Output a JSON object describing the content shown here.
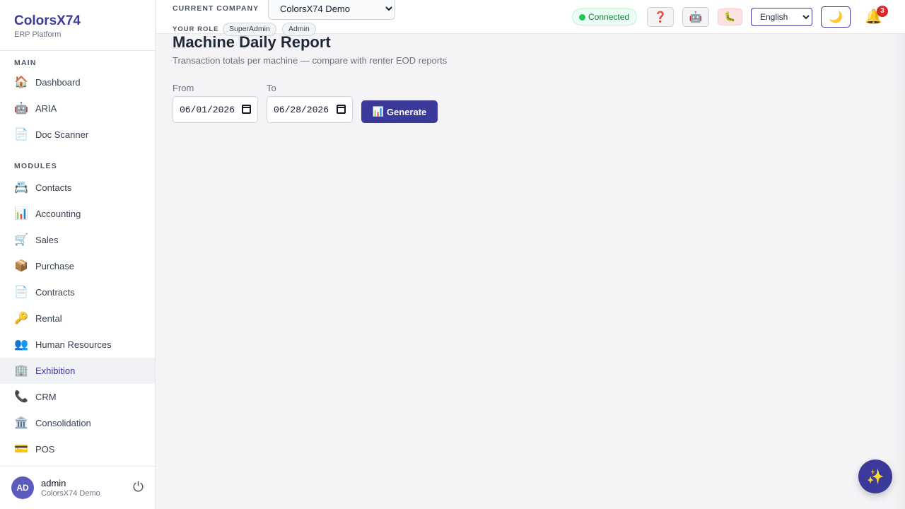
{
  "brand": {
    "name": "ColorsX74",
    "subtitle": "ERP Platform"
  },
  "sidebar": {
    "sections": [
      {
        "title": "MAIN",
        "items": [
          {
            "label": "Dashboard",
            "icon": "🏠"
          },
          {
            "label": "ARIA",
            "icon": "🤖"
          },
          {
            "label": "Doc Scanner",
            "icon": "📄"
          }
        ]
      },
      {
        "title": "MODULES",
        "items": [
          {
            "label": "Contacts",
            "icon": "📇"
          },
          {
            "label": "Accounting",
            "icon": "📊"
          },
          {
            "label": "Sales",
            "icon": "🛒"
          },
          {
            "label": "Purchase",
            "icon": "📦"
          },
          {
            "label": "Contracts",
            "icon": "📄"
          },
          {
            "label": "Rental",
            "icon": "🔑"
          },
          {
            "label": "Human Resources",
            "icon": "👥"
          },
          {
            "label": "Exhibition",
            "icon": "🏢",
            "active": true
          },
          {
            "label": "CRM",
            "icon": "📞"
          },
          {
            "label": "Consolidation",
            "icon": "🏛️"
          },
          {
            "label": "POS",
            "icon": "💳"
          }
        ]
      }
    ]
  },
  "user": {
    "initials": "AD",
    "name": "admin",
    "company": "ColorsX74 Demo",
    "logout_icon": "power-icon"
  },
  "topbar": {
    "company_label": "CURRENT COMPANY",
    "company_selected": "ColorsX74 Demo",
    "role_label": "YOUR ROLE",
    "roles": [
      "SuperAdmin",
      "Admin"
    ],
    "connection_status": "Connected",
    "help_icon": "❓",
    "bot_icon": "🤖",
    "bug_icon": "🐛",
    "language": "English",
    "theme_icon": "🌙",
    "bell_icon": "🔔",
    "notification_count": "3"
  },
  "page": {
    "title": "Machine Daily Report",
    "subtitle": "Transaction totals per machine — compare with renter EOD reports",
    "from_label": "From",
    "from_value": "06/01/2026",
    "to_label": "To",
    "to_value": "06/28/2026",
    "generate_icon": "📊",
    "generate_label": "Generate",
    "fab_icon": "✨"
  },
  "colors": {
    "accent": "#3b3a9a",
    "connected": "#22c55e",
    "badge": "#dc2626"
  }
}
